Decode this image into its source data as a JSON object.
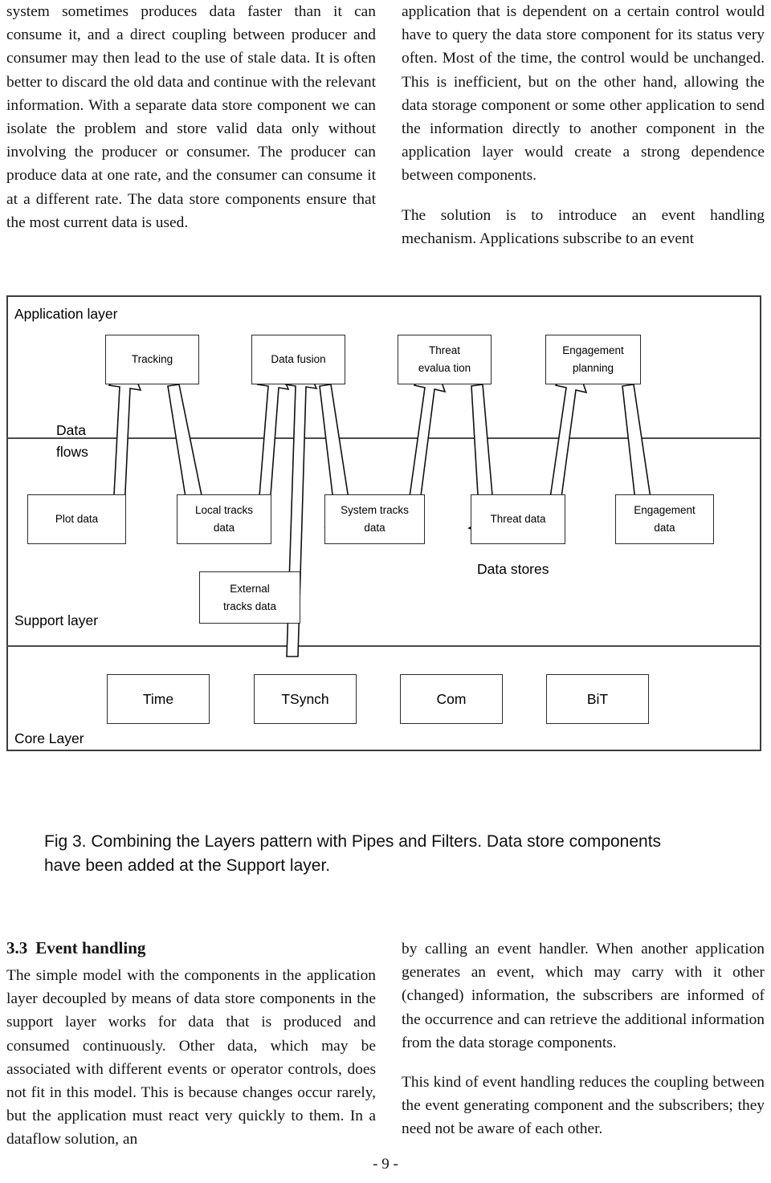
{
  "page": {
    "number_label": "- 9 -"
  },
  "columns": {
    "top_left": [
      "system sometimes produces data faster than it can consume it, and a direct coupling between producer and consumer may then lead to the use of stale data. It is often better to discard the old data and continue with the relevant information. With a separate data store component we can isolate the problem and store valid data only without involving the producer or consumer. The producer can produce data at one rate, and the consumer can consume it at a different rate. The data store components ensure that the most current data is used."
    ],
    "top_right": [
      "application that is dependent on a certain control would have to query the data store component for its status very often. Most of the time, the control would be unchanged. This is inefficient, but on the other hand, allowing the data storage component or some other application to send the information directly to another component in the application layer would create a strong dependence between components.",
      "The solution is to introduce an event handling mechanism. Applications subscribe to an event"
    ],
    "bottom_left": {
      "heading_number": "3.3",
      "heading_text": "Event handling",
      "paragraphs": [
        "The simple model with the components in the application layer decoupled by means of data store components in the support layer works for data that is produced and consumed continuously. Other data, which may be associated with different events or operator controls, does not fit in this model. This is because changes occur rarely, but the application must react very quickly to them. In a dataflow solution, an"
      ]
    },
    "bottom_right": [
      "by calling an event handler. When another application generates an event, which may carry with it other (changed) information, the subscribers are informed of the occurrence and can retrieve the additional information from the data storage components.",
      "This kind of event handling reduces the coupling between the event generating component and the subscribers; they need not be aware of each other."
    ]
  },
  "figure": {
    "caption": "Fig 3. Combining the Layers pattern with Pipes and Filters. Data store components have been added at the Support layer.",
    "labels": {
      "application_layer": "Application layer",
      "data_flows_line1": "Data",
      "data_flows_line2": "flows",
      "support_layer": "Support layer",
      "core_layer": "Core Layer",
      "data_stores": "Data stores"
    },
    "application_nodes": [
      {
        "id": "tracking",
        "line1": "Tracking",
        "line2": ""
      },
      {
        "id": "data-fusion",
        "line1": "Data fusion",
        "line2": ""
      },
      {
        "id": "threat-evaluation",
        "line1": "Threat",
        "line2": "evalua tion"
      },
      {
        "id": "engagement-planning",
        "line1": "Engagement",
        "line2": "planning"
      }
    ],
    "data_store_nodes": [
      {
        "id": "plot-data",
        "line1": "Plot data",
        "line2": ""
      },
      {
        "id": "local-tracks-data",
        "line1": "Local tracks",
        "line2": "data"
      },
      {
        "id": "system-tracks-data",
        "line1": "System tracks",
        "line2": "data"
      },
      {
        "id": "threat-data",
        "line1": "Threat data",
        "line2": ""
      },
      {
        "id": "engagement-data",
        "line1": "Engagement",
        "line2": "data"
      },
      {
        "id": "external-tracks-data",
        "line1": "External",
        "line2": "tracks data"
      }
    ],
    "core_nodes": [
      {
        "id": "time",
        "line1": "Time",
        "line2": ""
      },
      {
        "id": "tsynch",
        "line1": "TSynch",
        "line2": ""
      },
      {
        "id": "com",
        "line1": "Com",
        "line2": ""
      },
      {
        "id": "bit",
        "line1": "BiT",
        "line2": ""
      }
    ]
  },
  "chart_data": {
    "type": "diagram",
    "title": "Fig 3. Combining the Layers pattern with Pipes and Filters. Data store components have been added at the Support layer.",
    "layers": [
      "Application layer",
      "Support layer",
      "Core Layer"
    ],
    "nodes": [
      {
        "name": "Tracking",
        "layer": "Application layer"
      },
      {
        "name": "Data fusion",
        "layer": "Application layer"
      },
      {
        "name": "Threat evalua tion",
        "layer": "Application layer"
      },
      {
        "name": "Engagement planning",
        "layer": "Application layer"
      },
      {
        "name": "Plot data",
        "layer": "Support layer",
        "kind": "data store"
      },
      {
        "name": "Local tracks data",
        "layer": "Support layer",
        "kind": "data store"
      },
      {
        "name": "System tracks data",
        "layer": "Support layer",
        "kind": "data store"
      },
      {
        "name": "Threat data",
        "layer": "Support layer",
        "kind": "data store"
      },
      {
        "name": "Engagement data",
        "layer": "Support layer",
        "kind": "data store"
      },
      {
        "name": "External tracks data",
        "layer": "Support layer",
        "kind": "data store"
      },
      {
        "name": "Time",
        "layer": "Core Layer"
      },
      {
        "name": "TSynch",
        "layer": "Core Layer"
      },
      {
        "name": "Com",
        "layer": "Core Layer"
      },
      {
        "name": "BiT",
        "layer": "Core Layer"
      }
    ],
    "edges": [
      {
        "from": "Plot data",
        "to": "Tracking"
      },
      {
        "from": "Tracking",
        "to": "Local tracks data"
      },
      {
        "from": "Local tracks data",
        "to": "Data fusion"
      },
      {
        "from": "External tracks data",
        "to": "Data fusion"
      },
      {
        "from": "Data fusion",
        "to": "System tracks data"
      },
      {
        "from": "System tracks data",
        "to": "Threat evalua tion"
      },
      {
        "from": "Threat evalua tion",
        "to": "Threat data"
      },
      {
        "from": "Threat data",
        "to": "Engagement planning"
      },
      {
        "from": "Engagement planning",
        "to": "Engagement data"
      }
    ]
  }
}
